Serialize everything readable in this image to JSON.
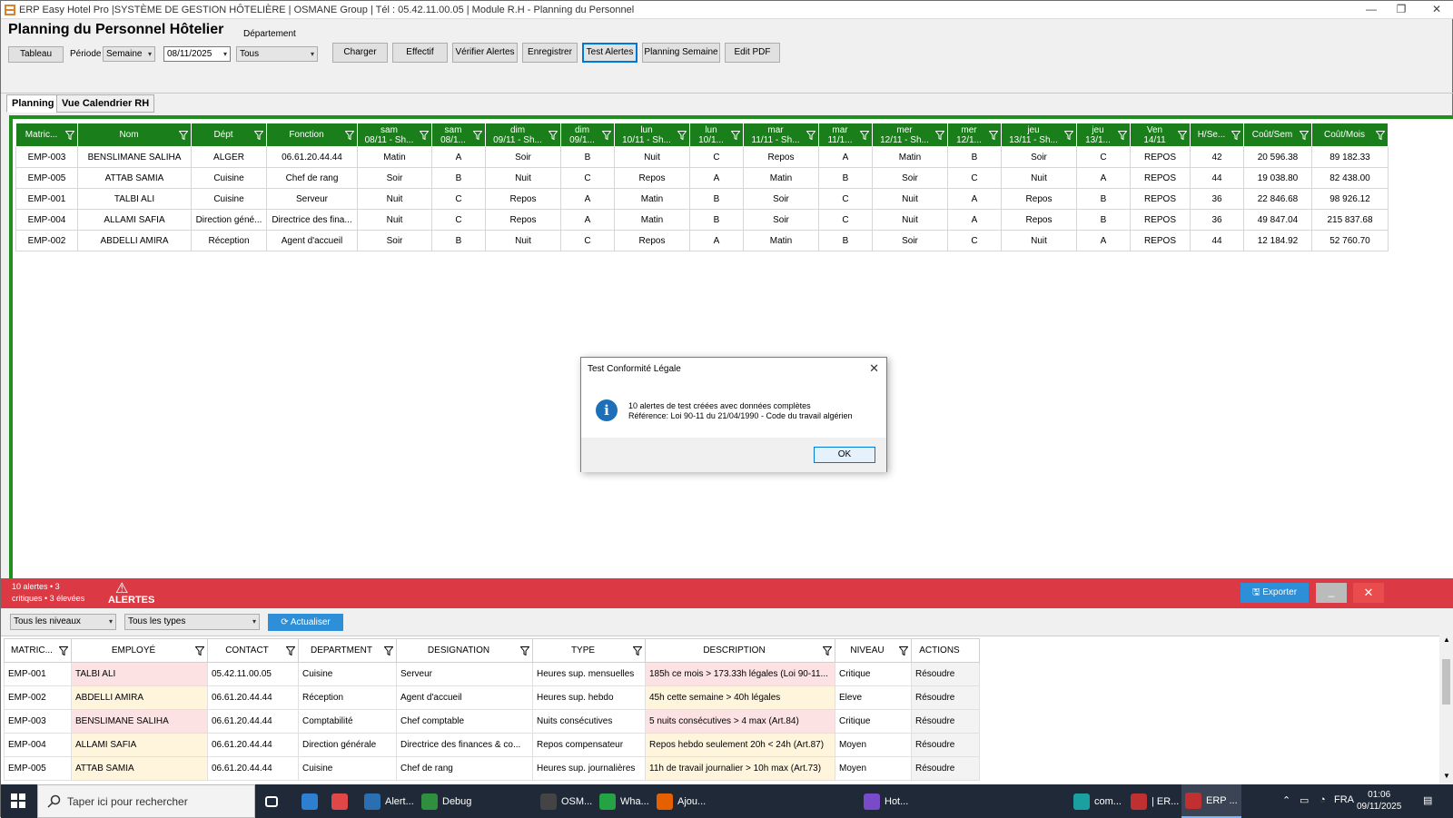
{
  "window": {
    "title": "ERP Easy Hotel Pro |SYSTÈME DE GESTION HÔTELIÈRE  | OSMANE Group | Tél : 05.42.11.00.05 | Module R.H - Planning du Personnel"
  },
  "page_title": "Planning du Personnel Hôtelier",
  "toolbar": {
    "tableau": "Tableau",
    "periode_label": "Période",
    "periode_value": "Semaine",
    "date_value": "08/11/2025",
    "departement_label": "Département",
    "departement_value": "Tous",
    "charger": "Charger",
    "effectif": "Effectif",
    "verifier_alertes": "Vérifier Alertes",
    "enregistrer": "Enregistrer",
    "test_alertes": "Test Alertes",
    "planning_semaine": "Planning Semaine",
    "edit_pdf": "Edit  PDF"
  },
  "tabs": [
    "Planning",
    "Vue Calendrier RH"
  ],
  "planning": {
    "columns": [
      "Matric...",
      "Nom",
      "Dépt",
      "Fonction",
      "sam\n08/11 - Sh...",
      "sam\n08/1...",
      "dim\n09/11 - Sh...",
      "dim\n09/1...",
      "lun\n10/11 - Sh...",
      "lun\n10/1...",
      "mar\n11/11 - Sh...",
      "mar\n11/1...",
      "mer\n12/11 - Sh...",
      "mer\n12/1...",
      "jeu\n13/11 - Sh...",
      "jeu\n13/1...",
      "Ven\n14/11",
      "H/Se...",
      "Coût/Sem",
      "Coût/Mois"
    ],
    "rows": [
      [
        "EMP-003",
        "BENSLIMANE SALIHA",
        "ALGER",
        "06.61.20.44.44",
        "Matin",
        "A",
        "Soir",
        "B",
        "Nuit",
        "C",
        "Repos",
        "A",
        "Matin",
        "B",
        "Soir",
        "C",
        "REPOS",
        "42",
        "20 596.38",
        "89 182.33"
      ],
      [
        "EMP-005",
        "ATTAB SAMIA",
        "Cuisine",
        "Chef de rang",
        "Soir",
        "B",
        "Nuit",
        "C",
        "Repos",
        "A",
        "Matin",
        "B",
        "Soir",
        "C",
        "Nuit",
        "A",
        "REPOS",
        "44",
        "19 038.80",
        "82 438.00"
      ],
      [
        "EMP-001",
        "TALBI ALI",
        "Cuisine",
        "Serveur",
        "Nuit",
        "C",
        "Repos",
        "A",
        "Matin",
        "B",
        "Soir",
        "C",
        "Nuit",
        "A",
        "Repos",
        "B",
        "REPOS",
        "36",
        "22 846.68",
        "98 926.12"
      ],
      [
        "EMP-004",
        "ALLAMI SAFIA",
        "Direction géné...",
        "Directrice des fina...",
        "Nuit",
        "C",
        "Repos",
        "A",
        "Matin",
        "B",
        "Soir",
        "C",
        "Nuit",
        "A",
        "Repos",
        "B",
        "REPOS",
        "36",
        "49 847.04",
        "215 837.68"
      ],
      [
        "EMP-002",
        "ABDELLI AMIRA",
        "Réception",
        "Agent d'accueil",
        "Soir",
        "B",
        "Nuit",
        "C",
        "Repos",
        "A",
        "Matin",
        "B",
        "Soir",
        "C",
        "Nuit",
        "A",
        "REPOS",
        "44",
        "12 184.92",
        "52 760.70"
      ]
    ]
  },
  "dialog": {
    "title": "Test Conformité Légale",
    "line1": "10 alertes de test créées avec données complètes",
    "line2": "Référence: Loi 90-11 du 21/04/1990 - Code du travail algérien",
    "ok": "OK"
  },
  "alert_bar": {
    "summary_line1": "10 alertes • 3",
    "summary_line2": "critiques • 3 élevées",
    "title": "ALERTES",
    "export": "Exporter",
    "minimize": "_",
    "close": "✕",
    "bg_color": "#db3a45"
  },
  "alert_filters": {
    "niveau": "Tous les niveaux",
    "types": "Tous les types",
    "actualiser": "Actualiser"
  },
  "alerts": {
    "columns": [
      "MATRIC...",
      "EMPLOYÉ",
      "CONTACT",
      "DEPARTMENT",
      "DESIGNATION",
      "TYPE",
      "DESCRIPTION",
      "NIVEAU",
      "ACTIONS"
    ],
    "rows": [
      [
        "EMP-001",
        "TALBI ALI",
        "05.42.11.00.05",
        "Cuisine",
        "Serveur",
        "Heures sup. mensuelles",
        "185h ce mois > 173.33h légales (Loi 90-11...",
        "Critique",
        "Résoudre"
      ],
      [
        "EMP-002",
        "ABDELLI AMIRA",
        "06.61.20.44.44",
        "Réception",
        "Agent d'accueil",
        "Heures sup. hebdo",
        "45h cette semaine > 40h légales",
        "Eleve",
        "Résoudre"
      ],
      [
        "EMP-003",
        "BENSLIMANE SALIHA",
        "06.61.20.44.44",
        "Comptabilité",
        "Chef comptable",
        "Nuits consécutives",
        "5 nuits consécutives > 4 max (Art.84)",
        "Critique",
        "Résoudre"
      ],
      [
        "EMP-004",
        "ALLAMI SAFIA",
        "06.61.20.44.44",
        "Direction générale",
        "Directrice des finances & co...",
        "Repos compensateur",
        "Repos hebdo seulement 20h < 24h (Art.87)",
        "Moyen",
        "Résoudre"
      ],
      [
        "EMP-005",
        "ATTAB SAMIA",
        "06.61.20.44.44",
        "Cuisine",
        "Chef de rang",
        "Heures sup. journalières",
        "11h de travail journalier > 10h max (Art.73)",
        "Moyen",
        "Résoudre"
      ]
    ]
  },
  "taskbar": {
    "search_placeholder": "Taper ici pour rechercher",
    "apps": [
      {
        "label": "Alert...",
        "icon": "alert-app-icon"
      },
      {
        "label": "Debug",
        "icon": "debug-icon"
      },
      {
        "label": "OSM...",
        "icon": "osm-icon"
      },
      {
        "label": "Wha...",
        "icon": "whatsapp-icon"
      },
      {
        "label": "Ajou...",
        "icon": "firefox-icon"
      },
      {
        "label": "Hot...",
        "icon": "visual-studio-icon"
      },
      {
        "label": "com...",
        "icon": "com-icon"
      },
      {
        "label": "| ER...",
        "icon": "erp-icon"
      },
      {
        "label": "ERP ...",
        "icon": "erp-active-icon"
      }
    ],
    "lang": "FRA",
    "time": "01:06",
    "date": "09/11/2025"
  }
}
